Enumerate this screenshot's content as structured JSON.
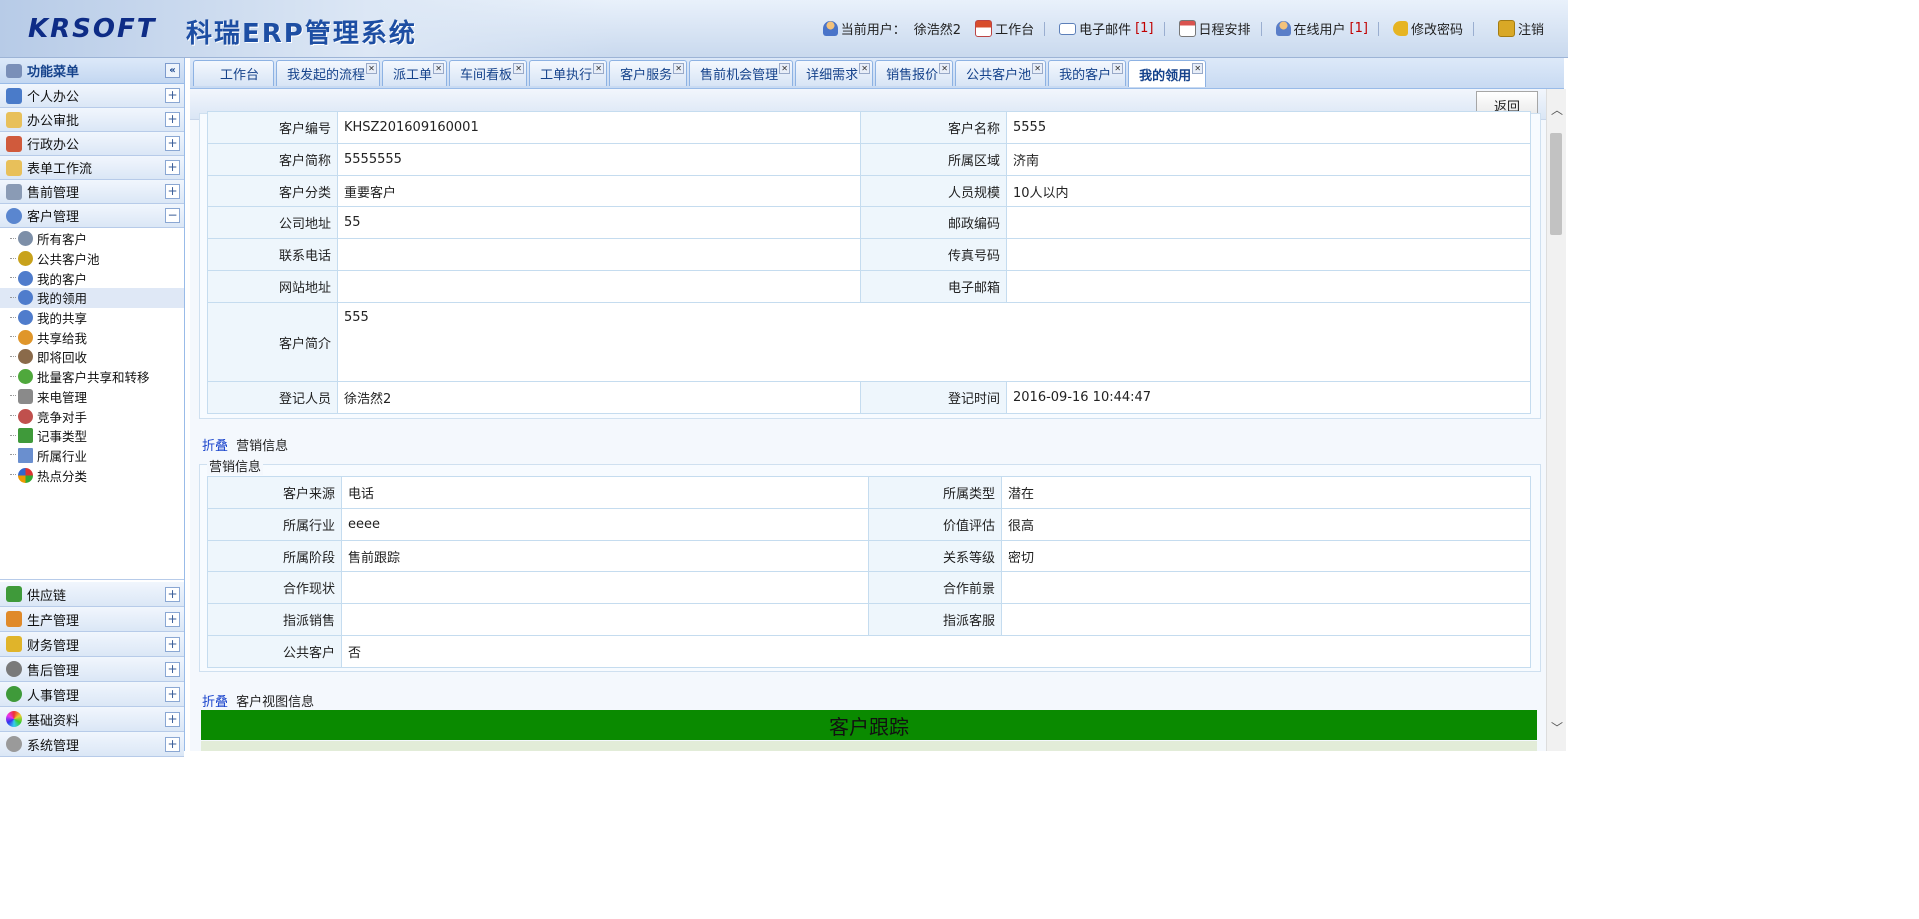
{
  "header": {
    "logo_en": "KRSOFT",
    "logo_cn": "科瑞ERP管理系统",
    "current_user_label": "当前用户：",
    "current_user": "徐浩然2",
    "workbench": "工作台",
    "email": "电子邮件",
    "email_count": "[1]",
    "schedule": "日程安排",
    "online_users": "在线用户",
    "online_count": "[1]",
    "change_password": "修改密码",
    "logout": "注销"
  },
  "sidebar": {
    "title": "功能菜单",
    "collapse_symbol": "«",
    "groups_top": [
      {
        "label": "个人办公",
        "toggle": "+"
      },
      {
        "label": "办公审批",
        "toggle": "+"
      },
      {
        "label": "行政办公",
        "toggle": "+"
      },
      {
        "label": "表单工作流",
        "toggle": "+"
      },
      {
        "label": "售前管理",
        "toggle": "+"
      },
      {
        "label": "客户管理",
        "toggle": "−"
      }
    ],
    "tree_items": [
      "所有客户",
      "公共客户池",
      "我的客户",
      "我的领用",
      "我的共享",
      "共享给我",
      "即将回收",
      "批量客户共享和转移",
      "来电管理",
      "竞争对手",
      "记事类型",
      "所属行业",
      "热点分类"
    ],
    "groups_bottom": [
      {
        "label": "供应链",
        "toggle": "+"
      },
      {
        "label": "生产管理",
        "toggle": "+"
      },
      {
        "label": "财务管理",
        "toggle": "+"
      },
      {
        "label": "售后管理",
        "toggle": "+"
      },
      {
        "label": "人事管理",
        "toggle": "+"
      },
      {
        "label": "基础资料",
        "toggle": "+"
      },
      {
        "label": "系统管理",
        "toggle": "+"
      }
    ]
  },
  "tabs": [
    "工作台",
    "我发起的流程",
    "派工单",
    "车间看板",
    "工单执行",
    "客户服务",
    "售前机会管理",
    "详细需求",
    "销售报价",
    "公共客户池",
    "我的客户",
    "我的领用"
  ],
  "toolbar": {
    "back_label": "返回"
  },
  "basic_info": {
    "customer_no_label": "客户编号",
    "customer_no": "KHSZ201609160001",
    "customer_name_label": "客户名称",
    "customer_name": "5555",
    "short_name_label": "客户简称",
    "short_name": "5555555",
    "region_label": "所属区域",
    "region": "济南",
    "category_label": "客户分类",
    "category": "重要客户",
    "staff_size_label": "人员规模",
    "staff_size": "10人以内",
    "address_label": "公司地址",
    "address": "55",
    "postcode_label": "邮政编码",
    "postcode": "",
    "phone_label": "联系电话",
    "phone": "",
    "fax_label": "传真号码",
    "fax": "",
    "website_label": "网站地址",
    "website": "",
    "email_label": "电子邮箱",
    "email": "",
    "intro_label": "客户简介",
    "intro": "555",
    "registrar_label": "登记人员",
    "registrar": "徐浩然2",
    "register_time_label": "登记时间",
    "register_time": "2016-09-16 10:44:47"
  },
  "marketing": {
    "fold_label": "折叠",
    "section_title": "营销信息",
    "legend": "营销信息",
    "source_label": "客户来源",
    "source": "电话",
    "type_label": "所属类型",
    "type": "潜在",
    "industry_label": "所属行业",
    "industry": "eeee",
    "value_label": "价值评估",
    "value": "很高",
    "stage_label": "所属阶段",
    "stage": "售前跟踪",
    "relation_label": "关系等级",
    "relation": "密切",
    "coop_status_label": "合作现状",
    "coop_status": "",
    "coop_outlook_label": "合作前景",
    "coop_outlook": "",
    "assigned_sales_label": "指派销售",
    "assigned_sales": "",
    "assigned_service_label": "指派客服",
    "assigned_service": "",
    "public_label": "公共客户",
    "public": "否"
  },
  "view_section": {
    "fold_label": "折叠",
    "title": "客户视图信息",
    "banner": "客户跟踪"
  },
  "colors": {
    "banner_green": "#0a8a00",
    "accent_blue": "#15428b",
    "count_red": "#c00000"
  }
}
